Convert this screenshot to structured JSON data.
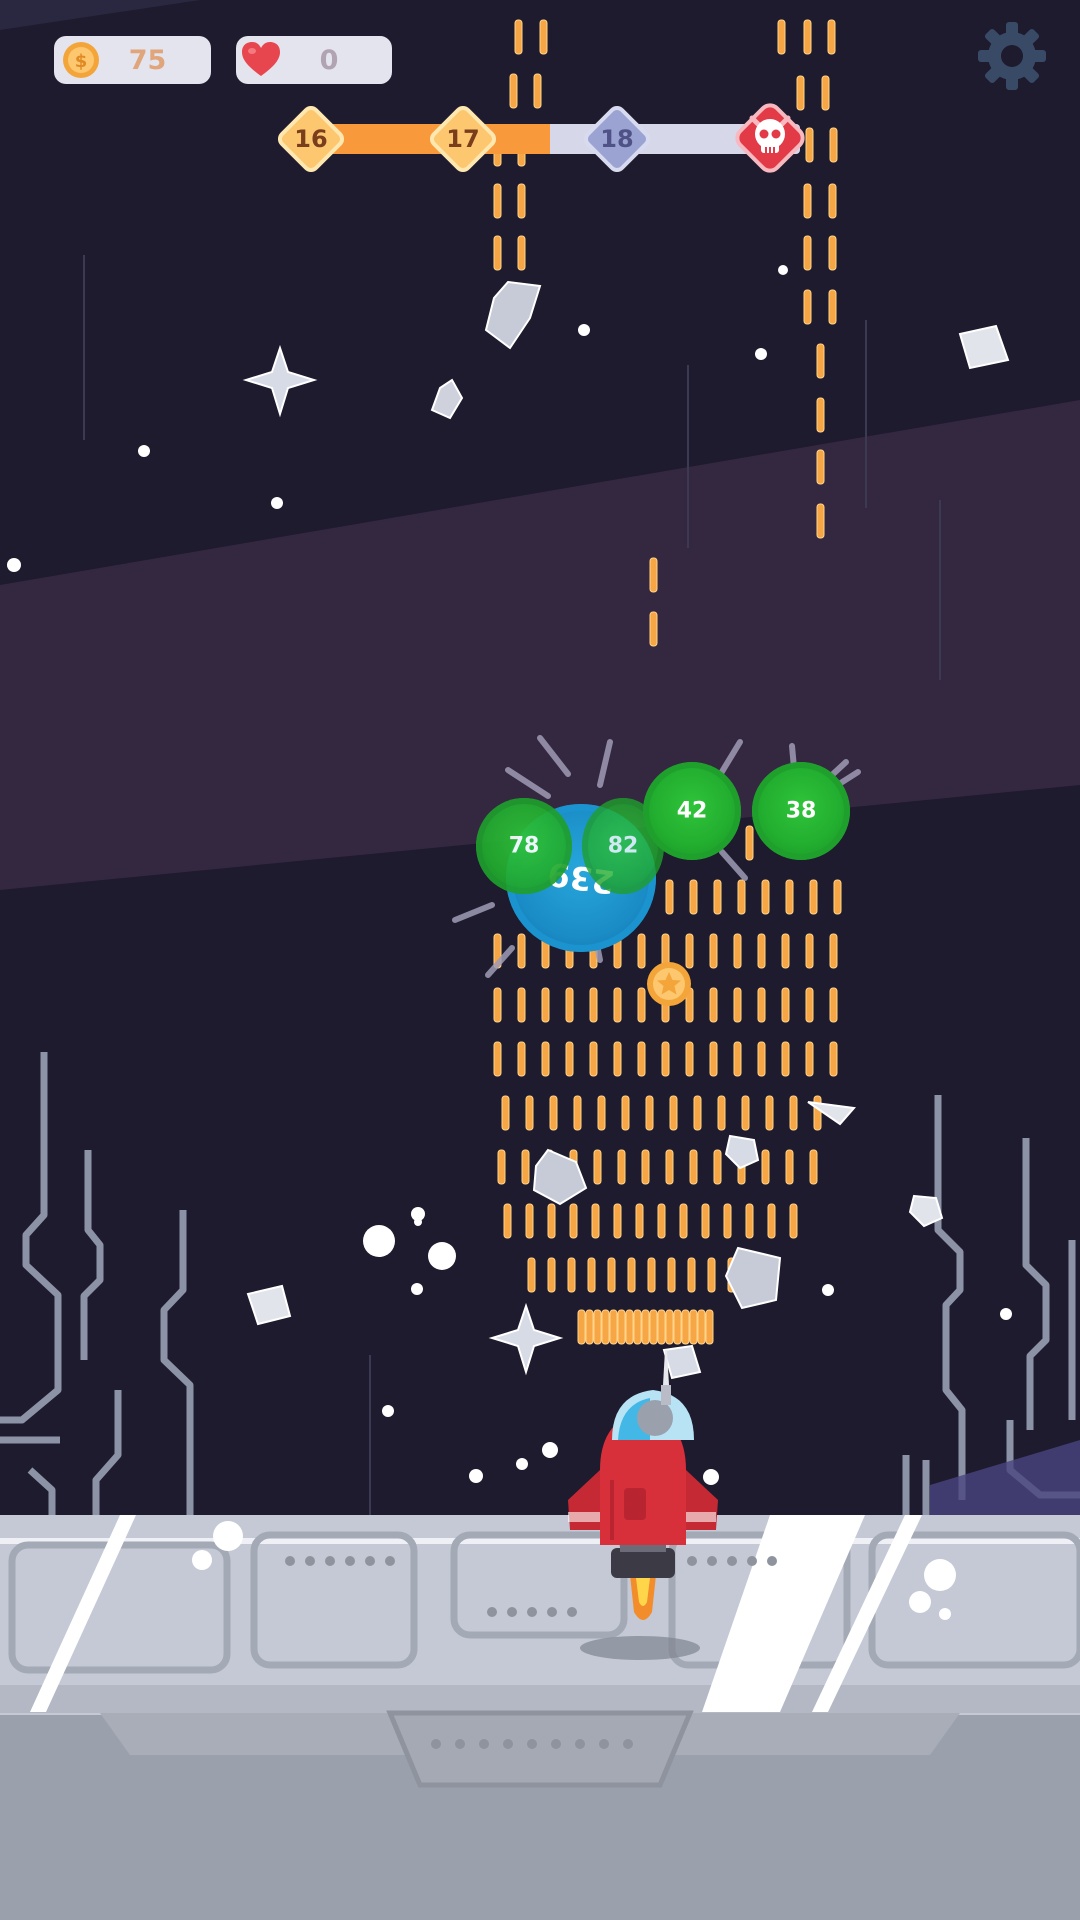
{
  "hud": {
    "coins": "75",
    "lives": "0"
  },
  "level_progress": {
    "levels": [
      {
        "label": "16",
        "state": "completed"
      },
      {
        "label": "17",
        "state": "completed"
      },
      {
        "label": "18",
        "state": "current"
      }
    ],
    "boss_icon": "skull-icon",
    "progress_fraction": 0.5
  },
  "enemies": [
    {
      "label": "239",
      "kind": "large-blue-virus"
    },
    {
      "label": "78",
      "kind": "green-virus"
    },
    {
      "label": "82",
      "kind": "green-virus"
    },
    {
      "label": "42",
      "kind": "green-virus"
    },
    {
      "label": "38",
      "kind": "green-virus"
    }
  ],
  "pickups": [
    {
      "kind": "gold-coin",
      "icon": "star-coin-icon"
    }
  ],
  "icons": [
    "coin-icon",
    "heart-icon",
    "gear-icon",
    "skull-icon",
    "star-coin-icon",
    "spaceship",
    "shuriken-icon"
  ],
  "colors": {
    "background": "#1d1b2d",
    "band": "#342840",
    "coin_text": "#e0a57b",
    "progress_fill": "#f89a3c",
    "enemy_green": "#22ad2f",
    "enemy_blue": "#1a8cc6",
    "bullet": "#f7a646",
    "ship_red": "#d7303a"
  }
}
